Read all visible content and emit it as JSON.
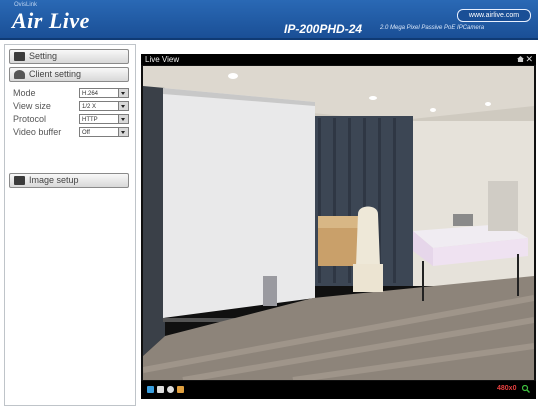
{
  "header": {
    "small_text": "OvisLink",
    "logo": "Air Live",
    "model": "IP-200PHD-24",
    "model_desc": "2.0 Mega Pixel Passive PoE IPCamera",
    "site_link": "www.airlive.com"
  },
  "sidebar": {
    "setting_label": "Setting",
    "client_setting_label": "Client setting",
    "image_setup_label": "Image setup",
    "fields": [
      {
        "label": "Mode",
        "value": "H.264"
      },
      {
        "label": "View size",
        "value": "1/2 X"
      },
      {
        "label": "Protocol",
        "value": "HTTP"
      },
      {
        "label": "Video buffer",
        "value": "Off"
      }
    ]
  },
  "live": {
    "title": "Live View",
    "status_text": "480x0"
  },
  "colors": {
    "header_blue": "#1f5aa5",
    "record_red": "#e84040",
    "zoom_green": "#3fbf3f"
  }
}
